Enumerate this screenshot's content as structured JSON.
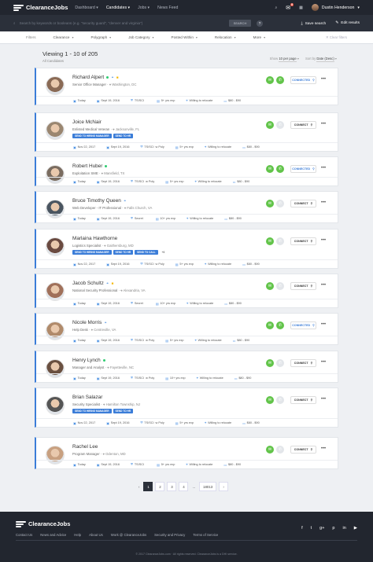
{
  "nav": {
    "brand": "ClearanceJobs",
    "menu": [
      "Dashboard",
      "Candidates",
      "Jobs",
      "News Feed"
    ],
    "active": "Candidates",
    "badge": "8",
    "user": "Dustin Henderson"
  },
  "search": {
    "placeholder": "Search by keywords or booleans (e.g. \"security guard\", \"denver and virginia\")",
    "button": "SEARCH",
    "help": "?",
    "save": "Save search",
    "edit": "Edit results"
  },
  "filters": {
    "label": "Filters",
    "items": [
      "Clearance",
      "Polygraph",
      "Job Category",
      "Posted Within",
      "Relocation",
      "More"
    ],
    "clear": "Clear filters"
  },
  "results": {
    "viewing": "Viewing 1 - 10 of 205",
    "scope": "All Candidates",
    "show_label": "Show",
    "show_value": "10 per page",
    "sort_label": "Sort by",
    "sort_value": "Date (Desc)"
  },
  "candidates": [
    {
      "name": "Richard Alpert",
      "title": "Senior Office Manager",
      "location": "Washington, DC",
      "online": true,
      "icons": [
        "linked",
        "star"
      ],
      "tags": [],
      "connected": true,
      "date": "Today",
      "updated": "Sept 19, 2016",
      "clearance": "TS/SCI",
      "polygraph": "",
      "exp": "5+ yrs exp",
      "relocate": "Willing to relocate",
      "salary": "$80 - $90",
      "photo": "#8a6a55"
    },
    {
      "name": "Joice McNair",
      "title": "Enlisted Medical Veteran",
      "location": "Jacksonville, FL",
      "online": false,
      "icons": [],
      "tags": [
        "SEND TO HIRING MANAGER",
        "SEND TO HR"
      ],
      "connected": false,
      "date": "Nov 22, 2017",
      "updated": "Sept 19, 2016",
      "clearance": "TS/SCI",
      "polygraph": "w Poly",
      "exp": "5+ yrs exp",
      "relocate": "Willing to relocate",
      "salary": "$80 - $90",
      "photo": "#9a8670"
    },
    {
      "name": "Robert Huber",
      "title": "Exploitation SME",
      "location": "Mansfield, TX",
      "online": true,
      "icons": [],
      "tags": [],
      "connected": true,
      "date": "Today",
      "updated": "Sept 19, 2016",
      "clearance": "TS/SCI",
      "polygraph": "w Poly",
      "exp": "5+ yrs exp",
      "relocate": "Willing to relocate",
      "salary": "$80 - $90",
      "photo": "#7a6c60"
    },
    {
      "name": "Bruce Timothy Queen",
      "title": "Web Developer - IT Professional",
      "location": "Falls Church, VA",
      "online": false,
      "icons": [
        "linked"
      ],
      "tags": [],
      "connected": false,
      "date": "Today",
      "updated": "Sept 19, 2016",
      "clearance": "Secret",
      "polygraph": "",
      "exp": "10+ yrs exp",
      "relocate": "Willing to relocate",
      "salary": "$80 - $90",
      "photo": "#4a5560"
    },
    {
      "name": "Marlaina Hawthorne",
      "title": "Logistics Specialist",
      "location": "Gaithersburg, MD",
      "online": false,
      "icons": [],
      "tags": [
        "SEND TO HIRING MANAGER",
        "SEND TO HR",
        "SEND TO CALL",
        "+6"
      ],
      "connected": false,
      "date": "Nov 22, 2017",
      "updated": "Sept 19, 2016",
      "clearance": "TS/SCI",
      "polygraph": "w Poly",
      "exp": "5+ yrs exp",
      "relocate": "Willing to relocate",
      "salary": "$80 - $90",
      "photo": "#6a4a40"
    },
    {
      "name": "Jacob Schultz",
      "title": "National Security Professional",
      "location": "Alexandria, VA",
      "online": false,
      "icons": [
        "linked",
        "star"
      ],
      "tags": [],
      "connected": false,
      "date": "Today",
      "updated": "Sept 19, 2016",
      "clearance": "Secret",
      "polygraph": "",
      "exp": "10+ yrs exp",
      "relocate": "Willing to relocate",
      "salary": "$80 - $90",
      "photo": "#a0705a"
    },
    {
      "name": "Nicole Morris",
      "title": "Help Desk",
      "location": "Centreville, VA",
      "online": false,
      "icons": [
        "linked"
      ],
      "tags": [],
      "connected": true,
      "date": "Today",
      "updated": "Sept 19, 2016",
      "clearance": "TS/SCI",
      "polygraph": "w Poly",
      "exp": "5+ yrs exp",
      "relocate": "Willing to relocate",
      "salary": "$80 - $90",
      "photo": "#b08a6a"
    },
    {
      "name": "Henry Lynch",
      "title": "Manager and Analyst",
      "location": "Fayetteville, NC",
      "online": true,
      "icons": [],
      "tags": [],
      "connected": false,
      "date": "Today",
      "updated": "Sept 19, 2016",
      "clearance": "TS/SCI",
      "polygraph": "w Poly",
      "exp": "10+ yrs exp",
      "relocate": "Willing to relocate",
      "salary": "$80 - $90",
      "photo": "#6a5040"
    },
    {
      "name": "Brian Salazar",
      "title": "Security Specialist",
      "location": "Hamilton Township, NJ",
      "online": false,
      "icons": [],
      "tags": [
        "SEND TO HIRING MANAGER",
        "SEND TO HR"
      ],
      "connected": false,
      "date": "Nov 22, 2017",
      "updated": "Sept 19, 2016",
      "clearance": "TS/SCI",
      "polygraph": "w Poly",
      "exp": "5+ yrs exp",
      "relocate": "Willing to relocate",
      "salary": "$80 - $90",
      "photo": "#555555"
    },
    {
      "name": "Rachel Lee",
      "title": "Program Manager",
      "location": "Odenton, MD",
      "online": false,
      "icons": [],
      "tags": [],
      "connected": false,
      "date": "Today",
      "updated": "Sept 19, 2016",
      "clearance": "TS/SCI",
      "polygraph": "",
      "exp": "5+ yrs exp",
      "relocate": "Willing to relocate",
      "salary": "$80 - $90",
      "photo": "#c8a080"
    }
  ],
  "labels": {
    "connected": "CONNECTED",
    "connect": "CONNECT"
  },
  "pagination": [
    "‹",
    "1",
    "2",
    "3",
    "4",
    "...",
    "18013",
    "›"
  ],
  "footer": {
    "brand": "ClearanceJobs",
    "links": [
      "Contact Us",
      "News and Advice",
      "Help",
      "About Us",
      "Work @ ClearanceJobs",
      "Security and Privacy",
      "Terms of Service"
    ],
    "copy": "© 2017 ClearanceJobs.com · All rights reserved. ClearanceJobs is a DHI service."
  },
  "social": [
    "f",
    "t",
    "g+",
    "p",
    "in",
    "▶"
  ]
}
